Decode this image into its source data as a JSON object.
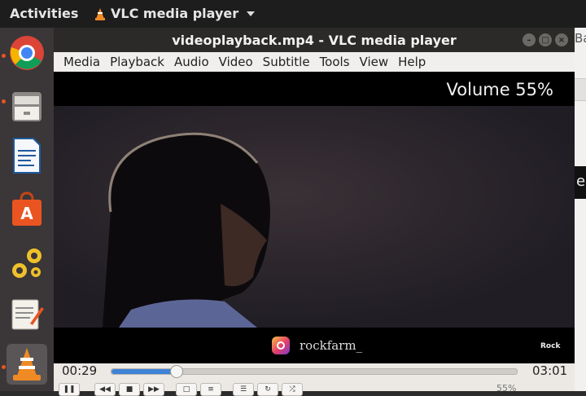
{
  "topbar": {
    "activities": "Activities",
    "app_name": "VLC media player"
  },
  "dock": {
    "items": [
      {
        "name": "Chrome",
        "icon": "chrome-icon"
      },
      {
        "name": "Files",
        "icon": "file-cabinet-icon"
      },
      {
        "name": "Writer",
        "icon": "writer-document-icon"
      },
      {
        "name": "Software",
        "icon": "store-bag-icon"
      },
      {
        "name": "Settings",
        "icon": "gears-icon"
      },
      {
        "name": "Text Editor",
        "icon": "notepad-icon"
      },
      {
        "name": "VLC",
        "icon": "vlc-cone-icon"
      }
    ]
  },
  "window": {
    "title": "videoplayback.mp4 - VLC media player",
    "menu": [
      "Media",
      "Playback",
      "Audio",
      "Video",
      "Subtitle",
      "Tools",
      "View",
      "Help"
    ],
    "osd": "Volume 55%",
    "watermark": "rockfarm_",
    "brand_small": "Rock",
    "current_time": "00:29",
    "total_time": "03:01",
    "progress": 0.16,
    "volume_text": "55%"
  },
  "right_window": {
    "label_top": "Ba",
    "label_mid": "e"
  },
  "colors": {
    "accent": "#3e83d6",
    "dock_bg": "#3b3638",
    "titlebar": "#2b2a28"
  }
}
